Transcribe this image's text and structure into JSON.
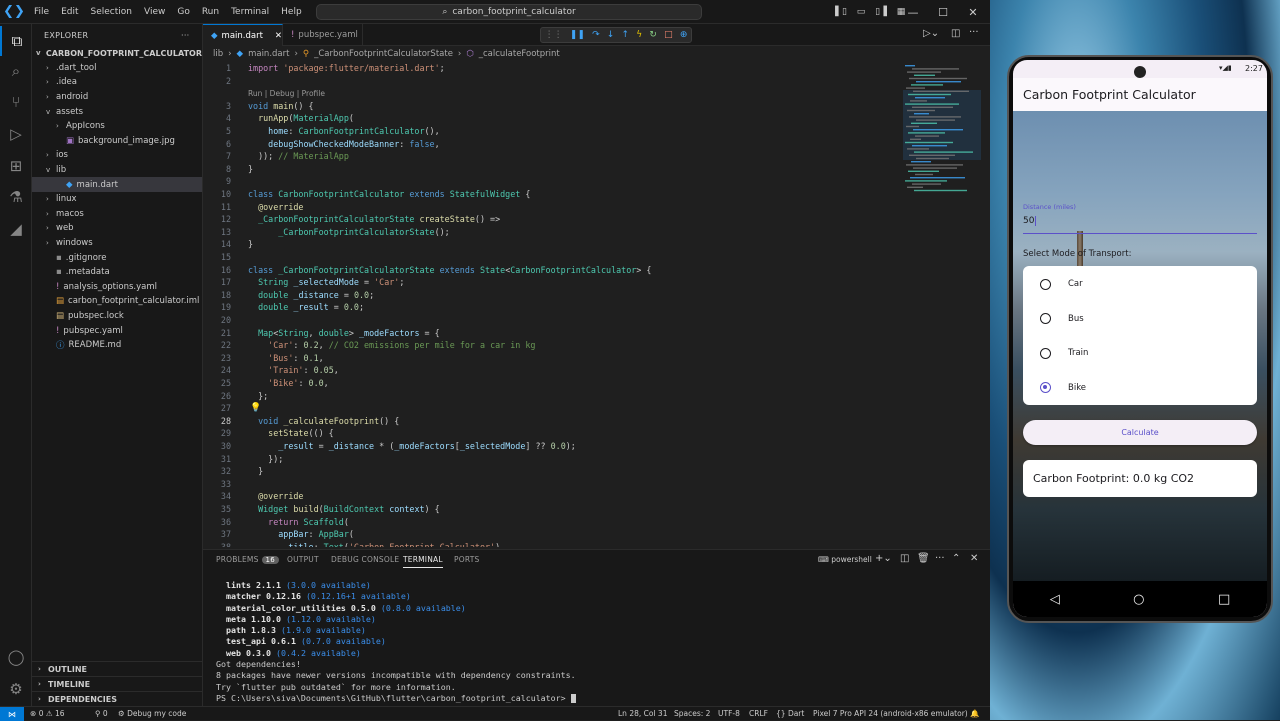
{
  "menu": [
    "File",
    "Edit",
    "Selection",
    "View",
    "Go",
    "Run",
    "Terminal",
    "Help"
  ],
  "search": {
    "text": "carbon_footprint_calculator"
  },
  "explorer": {
    "title": "EXPLORER",
    "root": "CARBON_FOOTPRINT_CALCULATOR",
    "items": [
      {
        "label": ".dart_tool",
        "depth": 1,
        "twisty": ">"
      },
      {
        "label": ".idea",
        "depth": 1,
        "twisty": ">"
      },
      {
        "label": "android",
        "depth": 1,
        "twisty": ">"
      },
      {
        "label": "assets",
        "depth": 1,
        "twisty": "v"
      },
      {
        "label": "AppIcons",
        "depth": 2,
        "twisty": ">"
      },
      {
        "label": "background_image.jpg",
        "depth": 2,
        "twisty": ""
      },
      {
        "label": "ios",
        "depth": 1,
        "twisty": ">"
      },
      {
        "label": "lib",
        "depth": 1,
        "twisty": "v"
      },
      {
        "label": "main.dart",
        "depth": 2,
        "twisty": "",
        "selected": true
      },
      {
        "label": "linux",
        "depth": 1,
        "twisty": ">"
      },
      {
        "label": "macos",
        "depth": 1,
        "twisty": ">"
      },
      {
        "label": "web",
        "depth": 1,
        "twisty": ">"
      },
      {
        "label": "windows",
        "depth": 1,
        "twisty": ">"
      },
      {
        "label": ".gitignore",
        "depth": 1,
        "twisty": ""
      },
      {
        "label": ".metadata",
        "depth": 1,
        "twisty": ""
      },
      {
        "label": "analysis_options.yaml",
        "depth": 1,
        "twisty": ""
      },
      {
        "label": "carbon_footprint_calculator.iml",
        "depth": 1,
        "twisty": ""
      },
      {
        "label": "pubspec.lock",
        "depth": 1,
        "twisty": ""
      },
      {
        "label": "pubspec.yaml",
        "depth": 1,
        "twisty": ""
      },
      {
        "label": "README.md",
        "depth": 1,
        "twisty": ""
      }
    ],
    "outline": "OUTLINE",
    "timeline": "TIMELINE",
    "dependencies": "DEPENDENCIES"
  },
  "tabs": [
    "main.dart",
    "pubspec.yaml"
  ],
  "breadcrumb": [
    "lib",
    "main.dart",
    "_CarbonFootprintCalculatorState",
    "_calculateFootprint"
  ],
  "codelens": "Run | Debug | Profile",
  "code_lines": [
    {
      "n": "1",
      "html": "<span class='m'>import</span> <span class='s'>'package:flutter/material.dart'</span>;"
    },
    {
      "n": "2",
      "html": ""
    },
    {
      "n": "3",
      "html": "<span class='k'>void</span> <span class='f'>main</span>() {"
    },
    {
      "n": "4",
      "html": "  <span class='f'>runApp</span>(<span class='c'>MaterialApp</span>("
    },
    {
      "n": "5",
      "html": "    <span class='v'>home</span>: <span class='c'>CarbonFootprintCalculator</span>(),"
    },
    {
      "n": "6",
      "html": "    <span class='v'>debugShowCheckedModeBanner</span>: <span class='k'>false</span>,"
    },
    {
      "n": "7",
      "html": "  )); <span class='cm'>// MaterialApp</span>"
    },
    {
      "n": "8",
      "html": "}"
    },
    {
      "n": "9",
      "html": ""
    },
    {
      "n": "10",
      "html": "<span class='k'>class</span> <span class='c'>CarbonFootprintCalculator</span> <span class='k'>extends</span> <span class='c'>StatefulWidget</span> {"
    },
    {
      "n": "11",
      "html": "  <span class='f'>@override</span>"
    },
    {
      "n": "12",
      "html": "  <span class='c'>_CarbonFootprintCalculatorState</span> <span class='f'>createState</span>() =>"
    },
    {
      "n": "13",
      "html": "      <span class='c'>_CarbonFootprintCalculatorState</span>();"
    },
    {
      "n": "14",
      "html": "}"
    },
    {
      "n": "15",
      "html": ""
    },
    {
      "n": "16",
      "html": "<span class='k'>class</span> <span class='c'>_CarbonFootprintCalculatorState</span> <span class='k'>extends</span> <span class='c'>State</span>&lt;<span class='c'>CarbonFootprintCalculator</span>&gt; {"
    },
    {
      "n": "17",
      "html": "  <span class='c'>String</span> <span class='v'>_selectedMode</span> = <span class='s'>'Car'</span>;"
    },
    {
      "n": "18",
      "html": "  <span class='c'>double</span> <span class='v'>_distance</span> = <span class='n'>0.0</span>;"
    },
    {
      "n": "19",
      "html": "  <span class='c'>double</span> <span class='v'>_result</span> = <span class='n'>0.0</span>;"
    },
    {
      "n": "20",
      "html": ""
    },
    {
      "n": "21",
      "html": "  <span class='c'>Map</span>&lt;<span class='c'>String</span>, <span class='c'>double</span>&gt; <span class='v'>_modeFactors</span> = {"
    },
    {
      "n": "22",
      "html": "    <span class='s'>'Car'</span>: <span class='n'>0.2</span>, <span class='cm'>// CO2 emissions per mile for a car in kg</span>"
    },
    {
      "n": "23",
      "html": "    <span class='s'>'Bus'</span>: <span class='n'>0.1</span>,"
    },
    {
      "n": "24",
      "html": "    <span class='s'>'Train'</span>: <span class='n'>0.05</span>,"
    },
    {
      "n": "25",
      "html": "    <span class='s'>'Bike'</span>: <span class='n'>0.0</span>,"
    },
    {
      "n": "26",
      "html": "  };"
    },
    {
      "n": "27",
      "html": ""
    },
    {
      "n": "28",
      "html": "  <span class='k'>void</span> <span class='f'>_calculateFootprint</span>() {"
    },
    {
      "n": "29",
      "html": "    <span class='f'>setState</span>(() {"
    },
    {
      "n": "30",
      "html": "      <span class='v'>_result</span> = <span class='v'>_distance</span> * (<span class='v'>_modeFactors</span>[<span class='v'>_selectedMode</span>] ?? <span class='n'>0.0</span>);"
    },
    {
      "n": "31",
      "html": "    });"
    },
    {
      "n": "32",
      "html": "  }"
    },
    {
      "n": "33",
      "html": ""
    },
    {
      "n": "34",
      "html": "  <span class='f'>@override</span>"
    },
    {
      "n": "35",
      "html": "  <span class='c'>Widget</span> <span class='f'>build</span>(<span class='c'>BuildContext</span> <span class='v'>context</span>) {"
    },
    {
      "n": "36",
      "html": "    <span class='m'>return</span> <span class='c'>Scaffold</span>("
    },
    {
      "n": "37",
      "html": "      <span class='v'>appBar</span>: <span class='c'>AppBar</span>("
    },
    {
      "n": "38",
      "html": "        <span class='v'>title</span>: <span class='c'>Text</span>(<span class='s'>'Carbon Footprint Calculator'</span>),"
    }
  ],
  "panel": {
    "tabs": [
      "PROBLEMS",
      "OUTPUT",
      "DEBUG CONSOLE",
      "TERMINAL",
      "PORTS"
    ],
    "problems_count": "16",
    "shell": "powershell"
  },
  "terminal": [
    {
      "pkg": "lints",
      "ver": "2.1.1",
      "avail": "(3.0.0 available)"
    },
    {
      "pkg": "matcher",
      "ver": "0.12.16",
      "avail": "(0.12.16+1 available)"
    },
    {
      "pkg": "material_color_utilities",
      "ver": "0.5.0",
      "avail": "(0.8.0 available)"
    },
    {
      "pkg": "meta",
      "ver": "1.10.0",
      "avail": "(1.12.0 available)"
    },
    {
      "pkg": "path",
      "ver": "1.8.3",
      "avail": "(1.9.0 available)"
    },
    {
      "pkg": "test_api",
      "ver": "0.6.1",
      "avail": "(0.7.0 available)"
    },
    {
      "pkg": "web",
      "ver": "0.3.0",
      "avail": "(0.4.2 available)"
    }
  ],
  "terminal_tail": [
    "Got dependencies!",
    "8 packages have newer versions incompatible with dependency constraints.",
    "Try `flutter pub outdated` for more information.",
    "PS C:\\Users\\siva\\Documents\\GitHub\\flutter\\carbon_footprint_calculator> "
  ],
  "status": {
    "errors": "0",
    "warnings": "16",
    "ports": "0",
    "debug": "Debug my code",
    "position": "Ln 28, Col 31",
    "spaces": "Spaces: 2",
    "encoding": "UTF-8",
    "eol": "CRLF",
    "language": "Dart",
    "device": "Pixel 7 Pro API 24 (android-x86 emulator)"
  },
  "phone": {
    "time": "2:27",
    "title": "Carbon Footprint Calculator",
    "distance_label": "Distance (miles)",
    "distance_value": "50",
    "mode_label": "Select Mode of Transport:",
    "modes": [
      "Car",
      "Bus",
      "Train",
      "Bike"
    ],
    "selected_mode": "Bike",
    "calculate": "Calculate",
    "result": "Carbon Footprint: 0.0 kg CO2"
  }
}
